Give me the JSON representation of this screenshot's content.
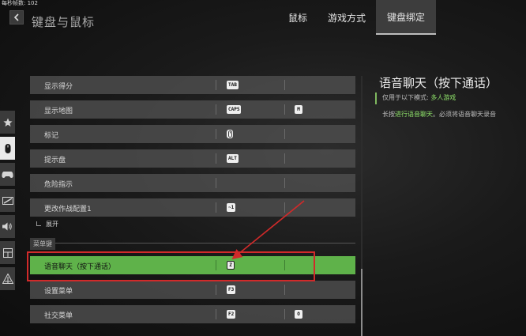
{
  "fps": {
    "label": "每秒帧数",
    "value": "102"
  },
  "header": {
    "title": "键盘与鼠标",
    "tabs": [
      {
        "label": "鼠标",
        "active": false
      },
      {
        "label": "游戏方式",
        "active": false
      },
      {
        "label": "键盘绑定",
        "active": true
      }
    ]
  },
  "sidebar": {
    "icons": [
      "star-icon",
      "mouse-icon",
      "gamepad-icon",
      "display-icon",
      "speaker-icon",
      "layout-icon",
      "radar-icon"
    ],
    "active": 1
  },
  "bindings": [
    {
      "label": "显示得分",
      "key1": "TAB",
      "key2": ""
    },
    {
      "label": "显示地图",
      "key1": "CAPS",
      "key2": "M"
    },
    {
      "label": "标记",
      "key1": "mouse-middle",
      "key2": ""
    },
    {
      "label": "提示盘",
      "key1": "ALT",
      "key2": ""
    },
    {
      "label": "危险指示",
      "key1": "",
      "key2": ""
    },
    {
      "label": "更改作战配置1",
      "key1": "~1",
      "key2": ""
    }
  ],
  "expand_label": "展开",
  "section": {
    "label": "菜单键"
  },
  "menu_bindings": [
    {
      "label": "语音聊天（按下通话）",
      "key1": "Z",
      "key2": "",
      "highlighted": true
    },
    {
      "label": "设置菜单",
      "key1": "F3",
      "key2": ""
    },
    {
      "label": "社交菜单",
      "key1": "F2",
      "key2": "O"
    }
  ],
  "detail": {
    "title": "语音聊天（按下通话）",
    "mode_prefix": "仅用于以下模式: ",
    "mode_value": "多人游戏",
    "desc_prefix": "长按",
    "desc_highlight": "进行语音聊天",
    "desc_suffix": "。必须将语音聊天录音"
  },
  "colors": {
    "highlight": "#5fb24a",
    "accent_text": "#8fe36a",
    "annotation": "#d12a2a"
  }
}
